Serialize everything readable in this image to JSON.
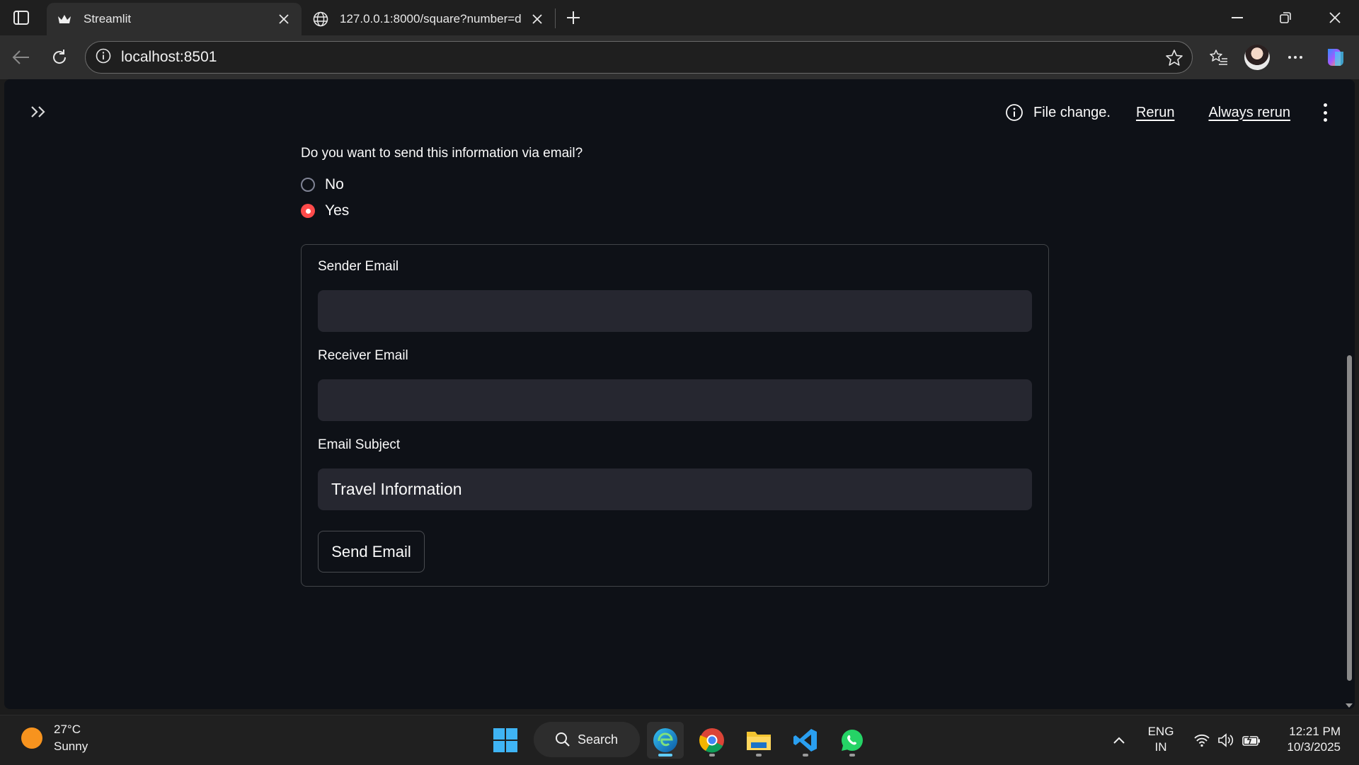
{
  "browser": {
    "tabs": [
      {
        "title": "Streamlit",
        "active": true
      },
      {
        "title": "127.0.0.1:8000/square?number=d",
        "active": false
      }
    ],
    "address": "localhost:8501"
  },
  "app": {
    "status": {
      "message": "File change.",
      "rerun_label": "Rerun",
      "always_rerun_label": "Always rerun"
    },
    "question": "Do you want to send this information via email?",
    "radio_options": [
      {
        "label": "No",
        "selected": false
      },
      {
        "label": "Yes",
        "selected": true
      }
    ],
    "form": {
      "sender_label": "Sender Email",
      "sender_value": "",
      "receiver_label": "Receiver Email",
      "receiver_value": "",
      "subject_label": "Email Subject",
      "subject_value": "Travel Information",
      "send_button": "Send Email"
    },
    "colors": {
      "accent": "#ff4b4b",
      "background": "#0e1117",
      "input_bg": "#262730"
    }
  },
  "taskbar": {
    "weather": {
      "temp": "27°C",
      "condition": "Sunny"
    },
    "search_label": "Search",
    "apps": [
      "windows-start",
      "edge",
      "chrome",
      "file-explorer",
      "vscode",
      "whatsapp"
    ],
    "language": {
      "line1": "ENG",
      "line2": "IN"
    },
    "time": "12:21 PM",
    "date": "10/3/2025"
  }
}
